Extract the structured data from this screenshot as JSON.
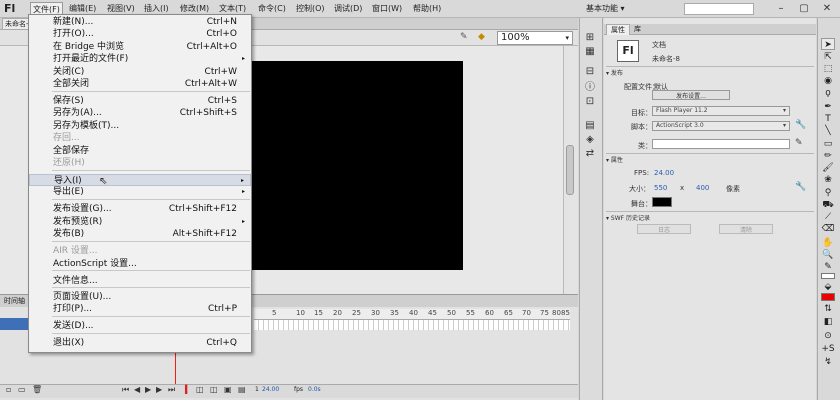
{
  "menubar": {
    "logo": "Fl",
    "items": [
      "文件(F)",
      "编辑(E)",
      "视图(V)",
      "插入(I)",
      "修改(M)",
      "文本(T)",
      "命令(C)",
      "控制(O)",
      "调试(D)",
      "窗口(W)",
      "帮助(H)"
    ],
    "workspace": "基本功能",
    "workspace_arrow": "▾",
    "window_buttons": [
      "–",
      "▢",
      "✕"
    ]
  },
  "document": {
    "tab": "未命名-",
    "zoom": "100%",
    "zoom_arrow": "▾"
  },
  "file_menu": {
    "items": [
      {
        "label": "新建(N)...",
        "shortcut": "Ctrl+N"
      },
      {
        "label": "打开(O)...",
        "shortcut": "Ctrl+O"
      },
      {
        "label": "在 Bridge 中浏览",
        "shortcut": "Ctrl+Alt+O"
      },
      {
        "label": "打开最近的文件(F)",
        "shortcut": "",
        "submenu": true
      },
      {
        "label": "关闭(C)",
        "shortcut": "Ctrl+W"
      },
      {
        "label": "全部关闭",
        "shortcut": "Ctrl+Alt+W"
      },
      {
        "label": "保存(S)",
        "shortcut": "Ctrl+S"
      },
      {
        "label": "另存为(A)...",
        "shortcut": "Ctrl+Shift+S"
      },
      {
        "label": "另存为模板(T)...",
        "shortcut": ""
      },
      {
        "label": "存回...",
        "shortcut": "",
        "disabled": true
      },
      {
        "label": "全部保存",
        "shortcut": ""
      },
      {
        "label": "还原(H)",
        "shortcut": "",
        "disabled": true
      },
      {
        "label": "导入(I)",
        "shortcut": "",
        "submenu": true,
        "highlighted": true
      },
      {
        "label": "导出(E)",
        "shortcut": "",
        "submenu": true
      },
      {
        "label": "发布设置(G)...",
        "shortcut": "Ctrl+Shift+F12"
      },
      {
        "label": "发布预览(R)",
        "shortcut": "",
        "submenu": true
      },
      {
        "label": "发布(B)",
        "shortcut": "Alt+Shift+F12"
      },
      {
        "label": "AIR 设置...",
        "shortcut": "",
        "disabled": true
      },
      {
        "label": "ActionScript 设置...",
        "shortcut": ""
      },
      {
        "label": "文件信息...",
        "shortcut": ""
      },
      {
        "label": "页面设置(U)...",
        "shortcut": ""
      },
      {
        "label": "打印(P)...",
        "shortcut": "Ctrl+P"
      },
      {
        "label": "发送(D)...",
        "shortcut": ""
      },
      {
        "label": "退出(X)",
        "shortcut": "Ctrl+Q"
      }
    ],
    "submenu_arrow": "▸"
  },
  "timeline": {
    "tab": "时间轴",
    "ruler": [
      "5",
      "10",
      "15",
      "20",
      "25",
      "30",
      "35",
      "40",
      "45",
      "50",
      "55",
      "60",
      "65",
      "70",
      "75",
      "80",
      "85"
    ],
    "frame": "1",
    "fps": "24.00",
    "fps_unit": "fps",
    "time": "0.0s"
  },
  "properties": {
    "tabs": [
      "属性",
      "库"
    ],
    "doc_type": "文档",
    "doc_name": "未命名-8",
    "publish_section": "发布",
    "profile_label": "配置文件：",
    "profile_value": "默认",
    "publish_settings_btn": "发布设置...",
    "target_label": "目标：",
    "target_value": "Flash Player 11.2",
    "script_label": "脚本：",
    "script_value": "ActionScript 3.0",
    "class_label": "类：",
    "props_section": "属性",
    "fps_label": "FPS:",
    "fps_value": "24.00",
    "size_label": "大小：",
    "width": "550",
    "size_x": "x",
    "height": "400",
    "size_unit": "像素",
    "stage_label": "舞台：",
    "stage_color": "#000000",
    "swf_section": "SWF 历史记录",
    "log_btn": "日志",
    "clear_btn": "清除"
  },
  "colors": {
    "stage": "#000000",
    "fill": "#e00000",
    "highlight": "#d7dbe4",
    "link": "#2a5db0"
  }
}
